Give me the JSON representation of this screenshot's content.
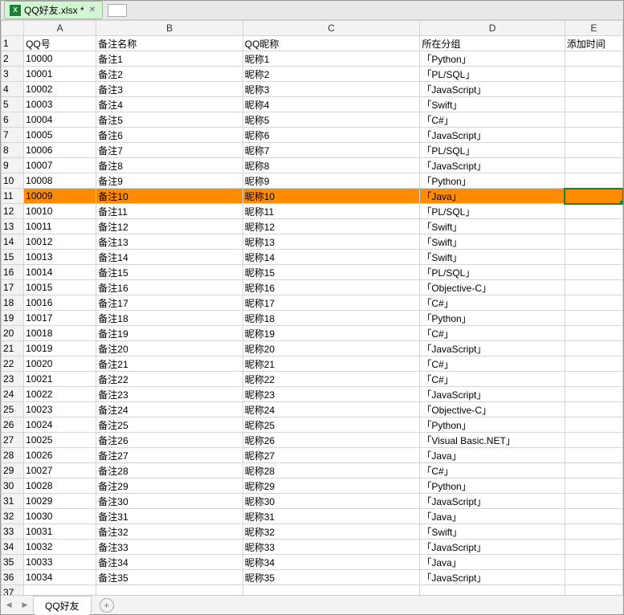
{
  "file_tab": {
    "name": "QQ好友.xlsx *"
  },
  "columns": [
    "A",
    "B",
    "C",
    "D",
    "E"
  ],
  "headers": {
    "A": "QQ号",
    "B": "备注名称",
    "C": "QQ昵称",
    "D": "所在分组",
    "E": "添加时间"
  },
  "highlight_row": 11,
  "active_cell": {
    "row": 11,
    "col": "E"
  },
  "visible_row_start": 1,
  "visible_row_end": 37,
  "rows": [
    {
      "n": 2,
      "A": "10000",
      "B": "备注1",
      "C": "昵称1",
      "D": "「Python」"
    },
    {
      "n": 3,
      "A": "10001",
      "B": "备注2",
      "C": "昵称2",
      "D": "「PL/SQL」"
    },
    {
      "n": 4,
      "A": "10002",
      "B": "备注3",
      "C": "昵称3",
      "D": "「JavaScript」"
    },
    {
      "n": 5,
      "A": "10003",
      "B": "备注4",
      "C": "昵称4",
      "D": "「Swift」"
    },
    {
      "n": 6,
      "A": "10004",
      "B": "备注5",
      "C": "昵称5",
      "D": "「C#」"
    },
    {
      "n": 7,
      "A": "10005",
      "B": "备注6",
      "C": "昵称6",
      "D": "「JavaScript」"
    },
    {
      "n": 8,
      "A": "10006",
      "B": "备注7",
      "C": "昵称7",
      "D": "「PL/SQL」"
    },
    {
      "n": 9,
      "A": "10007",
      "B": "备注8",
      "C": "昵称8",
      "D": "「JavaScript」"
    },
    {
      "n": 10,
      "A": "10008",
      "B": "备注9",
      "C": "昵称9",
      "D": "「Python」"
    },
    {
      "n": 11,
      "A": "10009",
      "B": "备注10",
      "C": "昵称10",
      "D": "「Java」"
    },
    {
      "n": 12,
      "A": "10010",
      "B": "备注11",
      "C": "昵称11",
      "D": "「PL/SQL」"
    },
    {
      "n": 13,
      "A": "10011",
      "B": "备注12",
      "C": "昵称12",
      "D": "「Swift」"
    },
    {
      "n": 14,
      "A": "10012",
      "B": "备注13",
      "C": "昵称13",
      "D": "「Swift」"
    },
    {
      "n": 15,
      "A": "10013",
      "B": "备注14",
      "C": "昵称14",
      "D": "「Swift」"
    },
    {
      "n": 16,
      "A": "10014",
      "B": "备注15",
      "C": "昵称15",
      "D": "「PL/SQL」"
    },
    {
      "n": 17,
      "A": "10015",
      "B": "备注16",
      "C": "昵称16",
      "D": "「Objective-C」"
    },
    {
      "n": 18,
      "A": "10016",
      "B": "备注17",
      "C": "昵称17",
      "D": "「C#」"
    },
    {
      "n": 19,
      "A": "10017",
      "B": "备注18",
      "C": "昵称18",
      "D": "「Python」"
    },
    {
      "n": 20,
      "A": "10018",
      "B": "备注19",
      "C": "昵称19",
      "D": "「C#」"
    },
    {
      "n": 21,
      "A": "10019",
      "B": "备注20",
      "C": "昵称20",
      "D": "「JavaScript」"
    },
    {
      "n": 22,
      "A": "10020",
      "B": "备注21",
      "C": "昵称21",
      "D": "「C#」"
    },
    {
      "n": 23,
      "A": "10021",
      "B": "备注22",
      "C": "昵称22",
      "D": "「C#」"
    },
    {
      "n": 24,
      "A": "10022",
      "B": "备注23",
      "C": "昵称23",
      "D": "「JavaScript」"
    },
    {
      "n": 25,
      "A": "10023",
      "B": "备注24",
      "C": "昵称24",
      "D": "「Objective-C」"
    },
    {
      "n": 26,
      "A": "10024",
      "B": "备注25",
      "C": "昵称25",
      "D": "「Python」"
    },
    {
      "n": 27,
      "A": "10025",
      "B": "备注26",
      "C": "昵称26",
      "D": "「Visual Basic.NET」"
    },
    {
      "n": 28,
      "A": "10026",
      "B": "备注27",
      "C": "昵称27",
      "D": "「Java」"
    },
    {
      "n": 29,
      "A": "10027",
      "B": "备注28",
      "C": "昵称28",
      "D": "「C#」"
    },
    {
      "n": 30,
      "A": "10028",
      "B": "备注29",
      "C": "昵称29",
      "D": "「Python」"
    },
    {
      "n": 31,
      "A": "10029",
      "B": "备注30",
      "C": "昵称30",
      "D": "「JavaScript」"
    },
    {
      "n": 32,
      "A": "10030",
      "B": "备注31",
      "C": "昵称31",
      "D": "「Java」"
    },
    {
      "n": 33,
      "A": "10031",
      "B": "备注32",
      "C": "昵称32",
      "D": "「Swift」"
    },
    {
      "n": 34,
      "A": "10032",
      "B": "备注33",
      "C": "昵称33",
      "D": "「JavaScript」"
    },
    {
      "n": 35,
      "A": "10033",
      "B": "备注34",
      "C": "昵称34",
      "D": "「Java」"
    },
    {
      "n": 36,
      "A": "10034",
      "B": "备注35",
      "C": "昵称35",
      "D": "「JavaScript」"
    },
    {
      "n": 37,
      "A": "",
      "B": "",
      "C": "",
      "D": ""
    }
  ],
  "sheet_tab": {
    "name": "QQ好友"
  }
}
